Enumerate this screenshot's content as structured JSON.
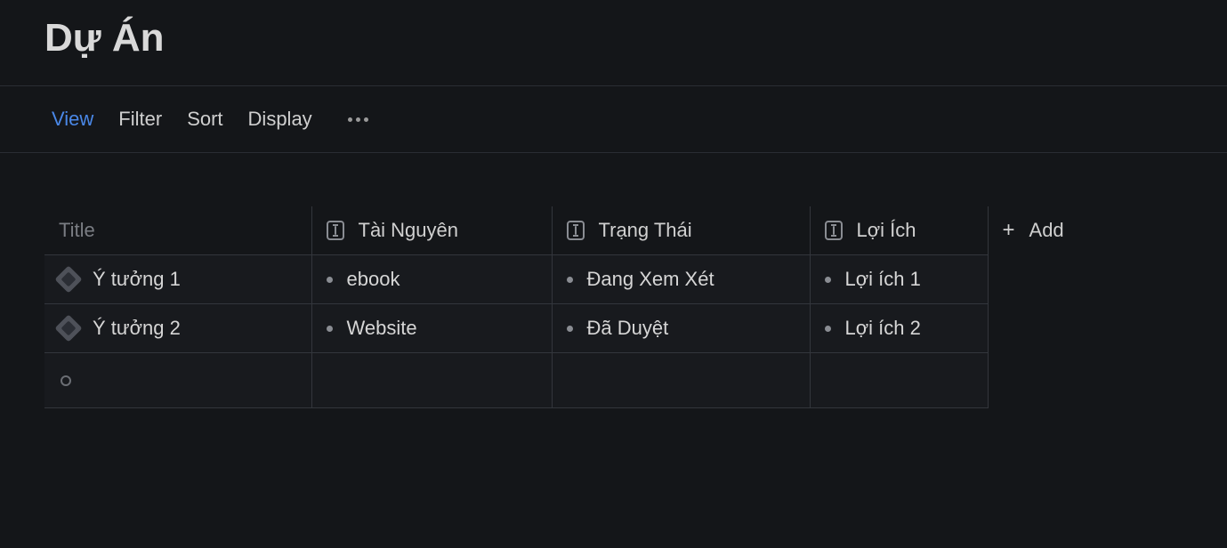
{
  "page": {
    "title": "Dự Án"
  },
  "toolbar": {
    "view": "View",
    "filter": "Filter",
    "sort": "Sort",
    "display": "Display"
  },
  "table": {
    "headers": {
      "title": "Title",
      "col1": "Tài Nguyên",
      "col2": "Trạng Thái",
      "col3": "Lợi Ích",
      "add": "Add"
    },
    "rows": [
      {
        "title": "Ý tưởng 1",
        "col1": "ebook",
        "col2": "Đang Xem Xét",
        "col3": "Lợi ích 1"
      },
      {
        "title": "Ý tưởng 2",
        "col1": "Website",
        "col2": "Đã Duyệt",
        "col3": "Lợi ích 2"
      }
    ]
  }
}
